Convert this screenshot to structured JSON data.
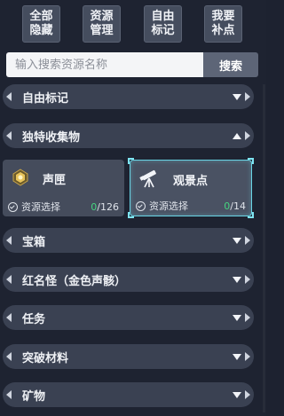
{
  "top_buttons": [
    {
      "line1": "全部",
      "line2": "隐藏"
    },
    {
      "line1": "资源",
      "line2": "管理"
    },
    {
      "line1": "自由",
      "line2": "标记"
    },
    {
      "line1": "我要",
      "line2": "补点"
    }
  ],
  "search": {
    "placeholder": "输入搜索资源名称",
    "button": "搜索"
  },
  "categories": [
    {
      "label": "自由标记",
      "expanded": false
    },
    {
      "label": "独特收集物",
      "expanded": true
    },
    {
      "label": "宝箱",
      "expanded": false
    },
    {
      "label": "红名怪（金色声骸）",
      "expanded": false
    },
    {
      "label": "任务",
      "expanded": false
    },
    {
      "label": "突破材料",
      "expanded": false
    },
    {
      "label": "矿物",
      "expanded": false
    }
  ],
  "resources": [
    {
      "name": "声匣",
      "select_label": "资源选择",
      "collected": "0",
      "total": "/126",
      "icon": "sound-box-icon",
      "selected": false
    },
    {
      "name": "观景点",
      "select_label": "资源选择",
      "collected": "0",
      "total": "/14",
      "icon": "telescope-icon",
      "selected": true
    }
  ],
  "colors": {
    "accent_green": "#46d480",
    "selected_border": "#6ad6e6"
  }
}
